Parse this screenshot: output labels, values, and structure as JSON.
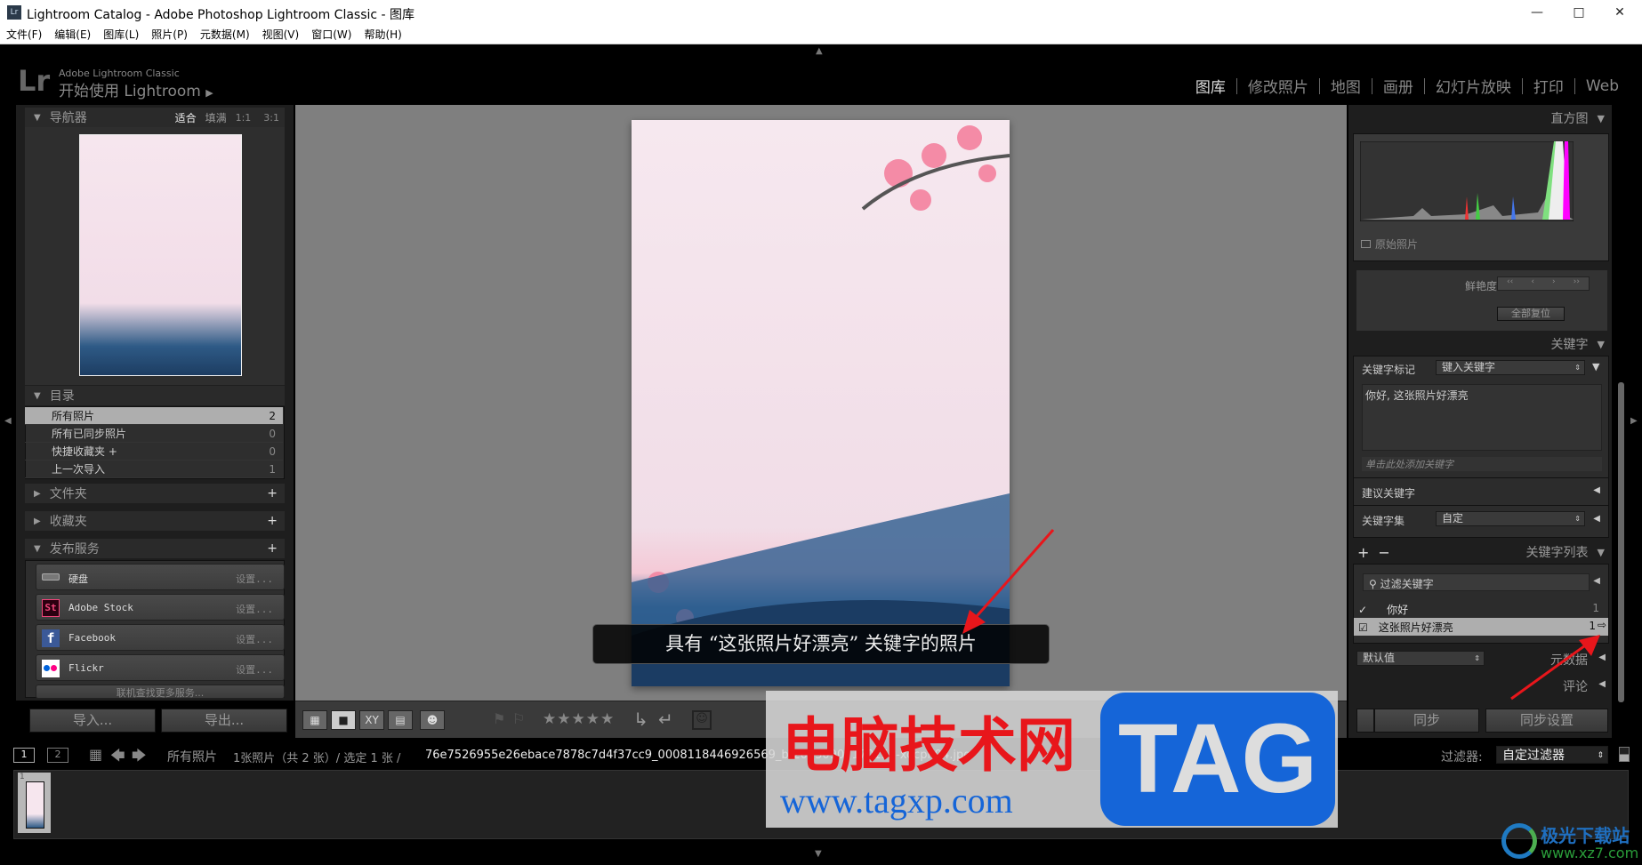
{
  "window": {
    "title": "Lightroom Catalog - Adobe Photoshop Lightroom Classic - 图库",
    "app_icon": "Lr",
    "controls": [
      "minimize",
      "maximize",
      "close"
    ]
  },
  "menu": [
    "文件(F)",
    "编辑(E)",
    "图库(L)",
    "照片(P)",
    "元数据(M)",
    "视图(V)",
    "窗口(W)",
    "帮助(H)"
  ],
  "identity": {
    "logo": "Lr",
    "line1": "Adobe Lightroom Classic",
    "line2": "开始使用 Lightroom"
  },
  "modules": [
    {
      "label": "图库",
      "active": true
    },
    {
      "label": "修改照片"
    },
    {
      "label": "地图"
    },
    {
      "label": "画册"
    },
    {
      "label": "幻灯片放映"
    },
    {
      "label": "打印"
    },
    {
      "label": "Web"
    }
  ],
  "navigator": {
    "title": "导航器",
    "zoom_options": [
      "适合",
      "填满",
      "1:1",
      "3:1"
    ],
    "selected": "适合"
  },
  "catalog": {
    "title": "目录",
    "items": [
      {
        "label": "所有照片",
        "count": "2",
        "selected": true
      },
      {
        "label": "所有已同步照片",
        "count": "0"
      },
      {
        "label": "快捷收藏夹 +",
        "count": "0"
      },
      {
        "label": "上一次导入",
        "count": "1"
      }
    ]
  },
  "folders": {
    "title": "文件夹"
  },
  "collections": {
    "title": "收藏夹"
  },
  "publish": {
    "title": "发布服务",
    "services": [
      {
        "name": "硬盘",
        "setup": "设置..."
      },
      {
        "name": "Adobe Stock",
        "setup": "设置..."
      },
      {
        "name": "Facebook",
        "setup": "设置..."
      },
      {
        "name": "Flickr",
        "setup": "设置..."
      }
    ],
    "find_more": "联机查找更多服务..."
  },
  "left_buttons": {
    "import": "导入...",
    "export": "导出..."
  },
  "histogram": {
    "title": "直方图",
    "original_label": "原始照片",
    "original_checked": false
  },
  "quick_develop": {
    "vibrance_label": "鲜艳度",
    "reset_all": "全部复位"
  },
  "keywording": {
    "title": "关键字",
    "tags_label": "关键字标记",
    "tags_value": "键入关键字",
    "keywords_text": "你好, 这张照片好漂亮",
    "add_placeholder": "单击此处添加关键字",
    "suggestions": "建议关键字",
    "set_label": "关键字集",
    "set_value": "自定"
  },
  "keyword_list": {
    "title": "关键字列表",
    "filter_placeholder": "过滤关键字",
    "items": [
      {
        "label": "你好",
        "count": "1",
        "checked": true
      },
      {
        "label": "这张照片好漂亮",
        "count": "1",
        "checked": true,
        "selected": true
      }
    ]
  },
  "metadata": {
    "preset": "默认值",
    "title": "元数据"
  },
  "comments": {
    "title": "评论"
  },
  "sync": {
    "sync": "同步",
    "sync_settings": "同步设置"
  },
  "caption": "具有 “这张照片好漂亮” 关键字的照片",
  "filmstrip": {
    "pages": [
      "1",
      "2"
    ],
    "source": "所有照片",
    "info": "1张照片（共 2 张）/ 选定 1 张 / ",
    "filename": "76e7526955e26ebace7878c7d4f37cc9_0008118446926569_b-20230907170150-xocpn94.jpg",
    "filter_label": "过滤器:",
    "filter_value": "自定过滤器",
    "thumb_index": "1"
  },
  "watermarks": {
    "tag_site": "电脑技术网",
    "tag_url": "www.tagxp.com",
    "tag_logo": "TAG",
    "xz7": "极光下载站",
    "xz7_url": "www.xz7.com"
  },
  "colors": {
    "accent_red": "#e8161b",
    "tag_blue": "#1565d8"
  }
}
